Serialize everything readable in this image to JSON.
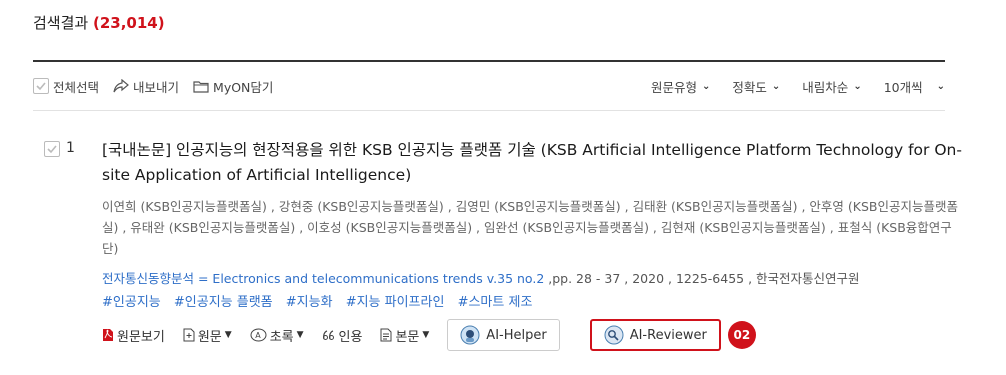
{
  "results": {
    "label": "검색결과",
    "count": "(23,014)"
  },
  "toolbar": {
    "select_all": "전체선택",
    "export": "내보내기",
    "myon": "MyON담기",
    "sorts": [
      {
        "label": "원문유형"
      },
      {
        "label": "정확도"
      },
      {
        "label": "내림차순"
      },
      {
        "label": "10개씩"
      }
    ]
  },
  "item": {
    "number": "1",
    "title": "[국내논문] 인공지능의 현장적용을 위한 KSB 인공지능 플랫폼 기술 (KSB Artificial Intelligence Platform Technology for On-site Application of Artificial Intelligence)",
    "authors": "이연희 (KSB인공지능플랫폼실) , 강현중 (KSB인공지능플랫폼실) , 김영민 (KSB인공지능플랫폼실) , 김태환 (KSB인공지능플랫폼실) , 안후영 (KSB인공지능플랫폼실) , 유태완 (KSB인공지능플랫폼실) , 이호성 (KSB인공지능플랫폼실) , 임완선 (KSB인공지능플랫폼실) , 김현재 (KSB인공지능플랫폼실) , 표철식 (KSB융합연구단)",
    "journal_name": "전자통신동향분석 = Electronics and telecommunications trends v.35 no.2",
    "journal_rest": " ,pp. 28 - 37 , 2020 , 1225-6455 , 한국전자통신연구원",
    "tags": [
      "#인공지능",
      "#인공지능 플랫폼",
      "#지능화",
      "#지능 파이프라인",
      "#스마트 제조"
    ],
    "actions": {
      "original_view": "원문보기",
      "original": "원문",
      "abstract": "초록",
      "cite": "인용",
      "body": "본문",
      "ai_helper": "AI-Helper",
      "ai_reviewer": "AI-Reviewer",
      "badge": "02"
    }
  },
  "colors": {
    "accent": "#d0121b",
    "link": "#2f6fc8"
  }
}
